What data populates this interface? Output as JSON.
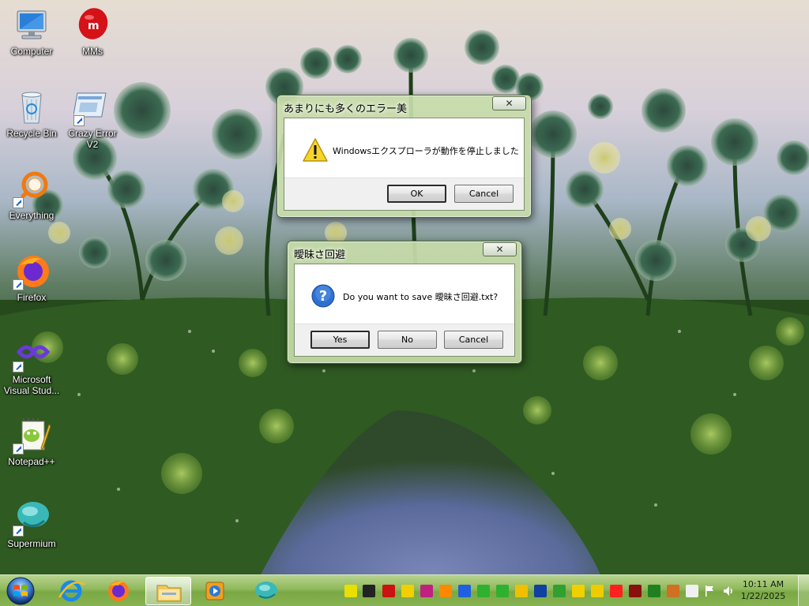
{
  "desktop": {
    "icons": [
      {
        "label": "Computer"
      },
      {
        "label": "MMs"
      },
      {
        "label": "Recycle Bin"
      },
      {
        "label": "Crazy Error V2"
      },
      {
        "label": "Everything"
      },
      {
        "label": "Firefox"
      },
      {
        "label": "Microsoft Visual Stud..."
      },
      {
        "label": "Notepad++"
      },
      {
        "label": "Supermium"
      }
    ]
  },
  "dialog_error": {
    "title": "あまりにも多くのエラー美",
    "close": "✕",
    "icon": "warning-icon",
    "message": "Windowsエクスプローラが動作を停止しました",
    "buttons": {
      "ok": "OK",
      "cancel": "Cancel"
    }
  },
  "dialog_save": {
    "title": "曖昧さ回避",
    "close": "✕",
    "icon": "question-icon",
    "message": "Do you want to save 曖昧さ回避.txt?",
    "buttons": {
      "yes": "Yes",
      "no": "No",
      "cancel": "Cancel"
    }
  },
  "taskbar": {
    "start_icon": "windows-logo-icon",
    "pinned": [
      {
        "name": "internet-explorer-icon"
      },
      {
        "name": "firefox-icon"
      },
      {
        "name": "file-explorer-icon"
      },
      {
        "name": "media-player-icon"
      },
      {
        "name": "supermium-icon"
      }
    ],
    "tray_colors": [
      "#e8e000",
      "#222222",
      "#cc1111",
      "#f0d000",
      "#c02080",
      "#ff8800",
      "#2060e0",
      "#30b030",
      "#f0c000",
      "#1040a0",
      "#30a030",
      "#f0d000",
      "#eecc00",
      "#ff2020",
      "#8a1010",
      "#208020",
      "#d07020",
      "#f0f0f0",
      "#ffffff",
      "#ffffff"
    ],
    "clock": {
      "time": "10:11 AM",
      "date": "1/22/2025"
    }
  }
}
